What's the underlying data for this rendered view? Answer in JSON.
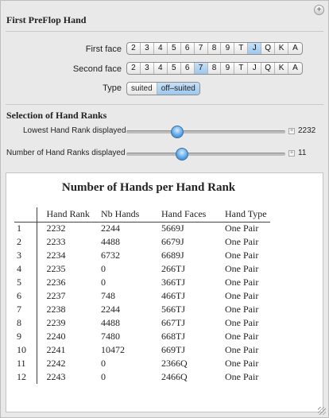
{
  "title": "First PreFlop Hand",
  "first_face": {
    "label": "First face",
    "options": [
      "2",
      "3",
      "4",
      "5",
      "6",
      "7",
      "8",
      "9",
      "T",
      "J",
      "Q",
      "K",
      "A"
    ],
    "selected": "J"
  },
  "second_face": {
    "label": "Second face",
    "options": [
      "2",
      "3",
      "4",
      "5",
      "6",
      "7",
      "8",
      "9",
      "T",
      "J",
      "Q",
      "K",
      "A"
    ],
    "selected": "7"
  },
  "type": {
    "label": "Type",
    "options": [
      "suited",
      "off–suited"
    ],
    "selected": "off–suited"
  },
  "selection_title": "Selection of Hand Ranks",
  "sliders": [
    {
      "label": "Lowest Hand Rank displayed",
      "value": "2232",
      "fraction": 0.32
    },
    {
      "label": "Number of Hand Ranks displayed",
      "value": "11",
      "fraction": 0.35
    }
  ],
  "output": {
    "title": "Number of Hands per Hand Rank",
    "headers": [
      "Hand Rank",
      "Nb Hands",
      "Hand Faces",
      "Hand Type"
    ],
    "rows": [
      [
        "1",
        "2232",
        "2244",
        "5669J",
        "One Pair"
      ],
      [
        "2",
        "2233",
        "4488",
        "6679J",
        "One Pair"
      ],
      [
        "3",
        "2234",
        "6732",
        "6689J",
        "One Pair"
      ],
      [
        "4",
        "2235",
        "0",
        "266TJ",
        "One Pair"
      ],
      [
        "5",
        "2236",
        "0",
        "366TJ",
        "One Pair"
      ],
      [
        "6",
        "2237",
        "748",
        "466TJ",
        "One Pair"
      ],
      [
        "7",
        "2238",
        "2244",
        "566TJ",
        "One Pair"
      ],
      [
        "8",
        "2239",
        "4488",
        "667TJ",
        "One Pair"
      ],
      [
        "9",
        "2240",
        "7480",
        "668TJ",
        "One Pair"
      ],
      [
        "10",
        "2241",
        "10472",
        "669TJ",
        "One Pair"
      ],
      [
        "11",
        "2242",
        "0",
        "2366Q",
        "One Pair"
      ],
      [
        "12",
        "2243",
        "0",
        "2466Q",
        "One Pair"
      ]
    ]
  },
  "icons": {
    "panel_toggle": "plus-icon",
    "slider_expand": "plus-icon",
    "resize": "resize-grip-icon"
  },
  "colors": {
    "selected": "#9cc8ee",
    "knob": "#5fa9e6"
  }
}
